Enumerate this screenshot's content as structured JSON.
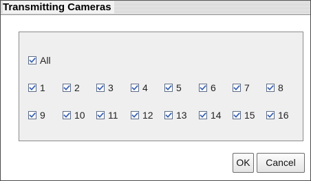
{
  "window": {
    "title": "Transmitting Cameras"
  },
  "all_checkbox": {
    "label": "All",
    "checked": true
  },
  "cameras": [
    {
      "label": "1",
      "checked": true
    },
    {
      "label": "2",
      "checked": true
    },
    {
      "label": "3",
      "checked": true
    },
    {
      "label": "4",
      "checked": true
    },
    {
      "label": "5",
      "checked": true
    },
    {
      "label": "6",
      "checked": true
    },
    {
      "label": "7",
      "checked": true
    },
    {
      "label": "8",
      "checked": true
    },
    {
      "label": "9",
      "checked": true
    },
    {
      "label": "10",
      "checked": true
    },
    {
      "label": "11",
      "checked": true
    },
    {
      "label": "12",
      "checked": true
    },
    {
      "label": "13",
      "checked": true
    },
    {
      "label": "14",
      "checked": true
    },
    {
      "label": "15",
      "checked": true
    },
    {
      "label": "16",
      "checked": true
    }
  ],
  "buttons": {
    "ok": "OK",
    "cancel": "Cancel"
  },
  "colors": {
    "checkmark": "#3b63b5",
    "checkbox_border": "#5a6a84",
    "group_background": "#efefef"
  },
  "icons": {
    "checkbox_checked": "checkmark-icon"
  }
}
